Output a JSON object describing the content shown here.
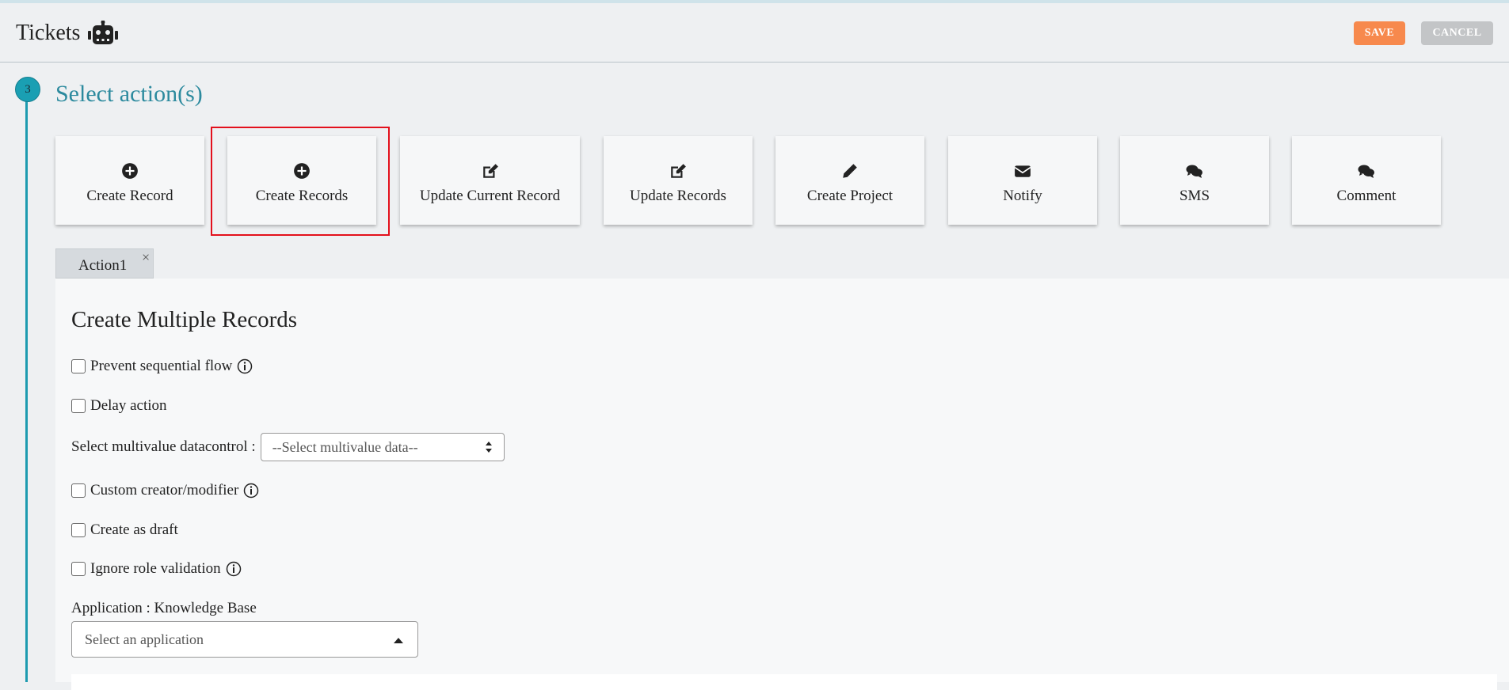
{
  "header": {
    "title": "Tickets",
    "title_icon": "robot-icon",
    "save_label": "SAVE",
    "cancel_label": "CANCEL"
  },
  "step": {
    "number": "3",
    "title": "Select action(s)"
  },
  "actions": [
    {
      "label": "Create Record",
      "icon": "plus-circle-icon"
    },
    {
      "label": "Create Records",
      "icon": "plus-circle-icon",
      "highlighted": true
    },
    {
      "label": "Update Current Record",
      "icon": "edit-icon"
    },
    {
      "label": "Update Records",
      "icon": "edit-icon"
    },
    {
      "label": "Create Project",
      "icon": "pencil-icon"
    },
    {
      "label": "Notify",
      "icon": "envelope-icon"
    },
    {
      "label": "SMS",
      "icon": "comments-icon"
    },
    {
      "label": "Comment",
      "icon": "comments-icon"
    }
  ],
  "tabs": [
    {
      "label": "Action1",
      "close": "×"
    }
  ],
  "form": {
    "title": "Create Multiple Records",
    "prevent_sequential_flow": "Prevent sequential flow",
    "delay_action": "Delay action",
    "multivalue_label": "Select multivalue datacontrol :",
    "multivalue_placeholder": "--Select multivalue data--",
    "custom_creator": "Custom creator/modifier",
    "create_as_draft": "Create as draft",
    "ignore_role_validation": "Ignore role validation",
    "application_label": "Application : Knowledge Base",
    "application_placeholder": "Select an application"
  },
  "colors": {
    "save": "#f7894d",
    "cancel": "#c3c5c7",
    "accent": "#1d9bb0",
    "highlight": "#e3101c"
  }
}
